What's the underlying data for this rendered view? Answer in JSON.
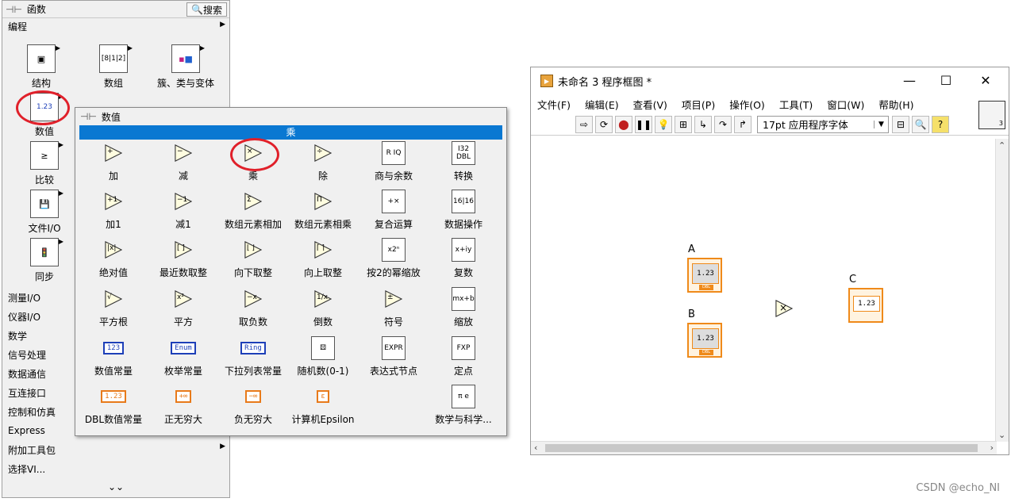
{
  "functions_palette": {
    "title": "函数",
    "search_label": "搜索",
    "category": "编程",
    "icons": [
      {
        "label": "结构",
        "icon": "structure-icon"
      },
      {
        "label": "数组",
        "icon": "array-icon"
      },
      {
        "label": "簇、类与变体",
        "icon": "cluster-icon"
      },
      {
        "label": "数值",
        "icon": "numeric-icon"
      },
      {
        "label": "比较",
        "icon": "comparison-icon"
      },
      {
        "label": "文件I/O",
        "icon": "file-io-icon"
      },
      {
        "label": "同步",
        "icon": "sync-icon"
      }
    ],
    "list": [
      "测量I/O",
      "仪器I/O",
      "数学",
      "信号处理",
      "数据通信",
      "互连接口",
      "控制和仿真",
      "Express",
      "附加工具包",
      "选择VI..."
    ],
    "expand_glyph": "⌄⌄"
  },
  "numeric_palette": {
    "title": "数值",
    "hover_name": "乘",
    "items": [
      {
        "label": "加",
        "glyph": "+"
      },
      {
        "label": "减",
        "glyph": "−"
      },
      {
        "label": "乘",
        "glyph": "×"
      },
      {
        "label": "除",
        "glyph": "÷"
      },
      {
        "label": "商与余数",
        "glyph": "R IQ"
      },
      {
        "label": "转换",
        "glyph": "I32 DBL"
      },
      {
        "label": "加1",
        "glyph": "+1"
      },
      {
        "label": "减1",
        "glyph": "−1"
      },
      {
        "label": "数组元素相加",
        "glyph": "Σ"
      },
      {
        "label": "数组元素相乘",
        "glyph": "Π"
      },
      {
        "label": "复合运算",
        "glyph": "+×"
      },
      {
        "label": "数据操作",
        "glyph": "16|16"
      },
      {
        "label": "绝对值",
        "glyph": "|x|"
      },
      {
        "label": "最近数取整",
        "glyph": "[ ]"
      },
      {
        "label": "向下取整",
        "glyph": "⌊ ⌋"
      },
      {
        "label": "向上取整",
        "glyph": "⌈ ⌉"
      },
      {
        "label": "按2的幂缩放",
        "glyph": "x2ⁿ"
      },
      {
        "label": "复数",
        "glyph": "x+iy"
      },
      {
        "label": "平方根",
        "glyph": "√"
      },
      {
        "label": "平方",
        "glyph": "x²"
      },
      {
        "label": "取负数",
        "glyph": "−x"
      },
      {
        "label": "倒数",
        "glyph": "1/x"
      },
      {
        "label": "符号",
        "glyph": "±"
      },
      {
        "label": "缩放",
        "glyph": "mx+b"
      },
      {
        "label": "数值常量",
        "glyph": "123"
      },
      {
        "label": "枚举常量",
        "glyph": "Enum"
      },
      {
        "label": "下拉列表常量",
        "glyph": "Ring"
      },
      {
        "label": "随机数(0-1)",
        "glyph": "⚄"
      },
      {
        "label": "表达式节点",
        "glyph": "EXPR"
      },
      {
        "label": "定点",
        "glyph": "FXP"
      },
      {
        "label": "DBL数值常量",
        "glyph": "1.23"
      },
      {
        "label": "正无穷大",
        "glyph": "+∞"
      },
      {
        "label": "负无穷大",
        "glyph": "−∞"
      },
      {
        "label": "计算机Epsilon",
        "glyph": "ε"
      },
      {
        "label": "数学与科学...",
        "glyph": "π e"
      }
    ]
  },
  "block_diagram": {
    "title": "未命名 3 程序框图 *",
    "app_icon": "labview-icon",
    "menus": [
      "文件(F)",
      "编辑(E)",
      "查看(V)",
      "项目(P)",
      "操作(O)",
      "工具(T)",
      "窗口(W)",
      "帮助(H)"
    ],
    "font": "17pt 应用程序字体",
    "vi_icon_number": "3",
    "nodes": {
      "A": {
        "label": "A",
        "value": "1.23",
        "type": "DBL"
      },
      "B": {
        "label": "B",
        "value": "1.23",
        "type": "DBL"
      },
      "C": {
        "label": "C",
        "value": "1.23",
        "type": "DBL"
      },
      "multiply_glyph": "×"
    }
  },
  "watermark": "CSDN @echo_NI"
}
